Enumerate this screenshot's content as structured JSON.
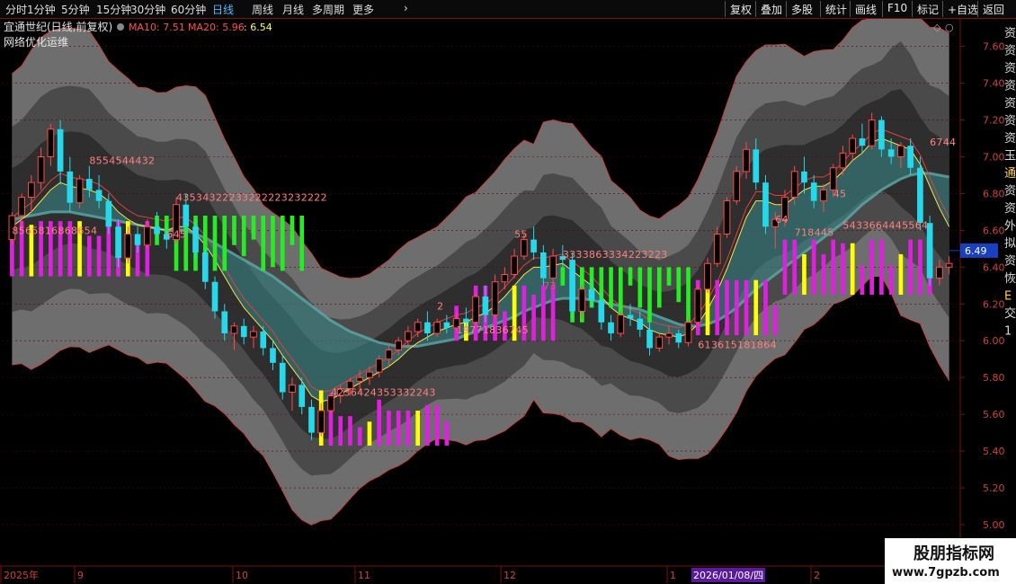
{
  "toolbar": {
    "periods": [
      "分时",
      "1分钟",
      "5分钟",
      "15分钟",
      "30分钟",
      "60分钟",
      "日线",
      "周线",
      "月线",
      "多周期",
      "更多"
    ],
    "active": "日线",
    "right_buttons": [
      "复权",
      "叠加",
      "多股",
      "统计",
      "画线",
      "F10",
      "标记",
      "+自选",
      "返回"
    ]
  },
  "legend": {
    "title": "宜通世纪(日线,前复权)",
    "ma10": "MA10: 7.51",
    "ma20": "MA20: 5.96",
    "extra": ": 6.54",
    "indicator": "网络优化运维"
  },
  "colors": {
    "up": "#ff4a4a",
    "down": "#26d9ea",
    "magenta": "#e020e0",
    "green": "#22ee22",
    "yellow": "#ffff00",
    "teal": "#3a8c8c",
    "axis": "#7a1010"
  },
  "date_axis": {
    "labels": [
      "2025年",
      "9",
      "10",
      "11",
      "12",
      "1",
      "2"
    ],
    "cursor": "2026/01/08/四"
  },
  "price_tag": "6.49",
  "watermark": {
    "title": "股朋指标网",
    "url": "www.7gpzb.com"
  },
  "right_glyphs": [
    "资",
    "资",
    "资",
    "资",
    "资",
    "资",
    "资",
    "玉",
    "通",
    "资",
    "资",
    "外",
    "拟",
    "资",
    "恢",
    "E",
    "交",
    "1"
  ],
  "chart_data": {
    "type": "candlestick",
    "y_ticks": [
      7.6,
      7.4,
      7.2,
      7.0,
      6.8,
      6.6,
      6.4,
      6.2,
      6.0,
      5.8,
      5.6,
      5.4,
      5.2,
      5.0
    ],
    "ylim": [
      4.78,
      7.74
    ],
    "candles": [
      [
        6.55,
        6.7,
        6.52,
        6.68
      ],
      [
        6.68,
        6.8,
        6.6,
        6.78
      ],
      [
        6.78,
        6.9,
        6.7,
        6.86
      ],
      [
        6.86,
        7.05,
        6.82,
        7.0
      ],
      [
        7.0,
        7.18,
        6.95,
        7.15
      ],
      [
        7.15,
        7.2,
        6.85,
        6.92
      ],
      [
        6.92,
        7.0,
        6.7,
        6.75
      ],
      [
        6.75,
        6.9,
        6.72,
        6.88
      ],
      [
        6.88,
        6.95,
        6.78,
        6.82
      ],
      [
        6.82,
        6.9,
        6.72,
        6.76
      ],
      [
        6.76,
        6.8,
        6.58,
        6.62
      ],
      [
        6.62,
        6.66,
        6.4,
        6.45
      ],
      [
        6.45,
        6.62,
        6.42,
        6.58
      ],
      [
        6.58,
        6.62,
        6.48,
        6.52
      ],
      [
        6.52,
        6.66,
        6.5,
        6.62
      ],
      [
        6.62,
        6.7,
        6.55,
        6.58
      ],
      [
        6.58,
        6.62,
        6.5,
        6.55
      ],
      [
        6.55,
        6.78,
        6.53,
        6.74
      ],
      [
        6.74,
        6.8,
        6.58,
        6.62
      ],
      [
        6.62,
        6.65,
        6.44,
        6.48
      ],
      [
        6.48,
        6.5,
        6.28,
        6.32
      ],
      [
        6.32,
        6.35,
        6.12,
        6.16
      ],
      [
        6.16,
        6.2,
        6.0,
        6.04
      ],
      [
        6.04,
        6.1,
        5.95,
        6.08
      ],
      [
        6.08,
        6.12,
        5.98,
        6.02
      ],
      [
        6.02,
        6.08,
        5.96,
        6.05
      ],
      [
        6.05,
        6.08,
        5.92,
        5.96
      ],
      [
        5.96,
        6.0,
        5.84,
        5.88
      ],
      [
        5.88,
        5.92,
        5.68,
        5.72
      ],
      [
        5.72,
        5.8,
        5.62,
        5.76
      ],
      [
        5.76,
        5.8,
        5.6,
        5.64
      ],
      [
        5.64,
        5.68,
        5.46,
        5.5
      ],
      [
        5.5,
        5.66,
        5.48,
        5.62
      ],
      [
        5.62,
        5.72,
        5.6,
        5.7
      ],
      [
        5.7,
        5.76,
        5.66,
        5.74
      ],
      [
        5.74,
        5.8,
        5.7,
        5.78
      ],
      [
        5.78,
        5.84,
        5.72,
        5.8
      ],
      [
        5.8,
        5.86,
        5.76,
        5.83
      ],
      [
        5.83,
        5.92,
        5.8,
        5.9
      ],
      [
        5.9,
        5.98,
        5.86,
        5.95
      ],
      [
        5.95,
        6.02,
        5.92,
        6.0
      ],
      [
        6.0,
        6.08,
        5.96,
        6.05
      ],
      [
        6.05,
        6.12,
        6.02,
        6.1
      ],
      [
        6.1,
        6.16,
        6.0,
        6.04
      ],
      [
        6.04,
        6.12,
        6.02,
        6.1
      ],
      [
        6.1,
        6.14,
        6.04,
        6.07
      ],
      [
        6.07,
        6.15,
        6.05,
        6.12
      ],
      [
        6.12,
        6.18,
        6.06,
        6.1
      ],
      [
        6.1,
        6.26,
        6.08,
        6.24
      ],
      [
        6.24,
        6.3,
        6.1,
        6.14
      ],
      [
        6.14,
        6.36,
        6.12,
        6.32
      ],
      [
        6.32,
        6.4,
        6.28,
        6.36
      ],
      [
        6.36,
        6.5,
        6.34,
        6.46
      ],
      [
        6.46,
        6.58,
        6.44,
        6.55
      ],
      [
        6.55,
        6.62,
        6.44,
        6.48
      ],
      [
        6.48,
        6.52,
        6.3,
        6.34
      ],
      [
        6.34,
        6.5,
        6.3,
        6.46
      ],
      [
        6.46,
        6.52,
        6.4,
        6.44
      ],
      [
        6.44,
        6.48,
        6.12,
        6.16
      ],
      [
        6.16,
        6.3,
        6.12,
        6.28
      ],
      [
        6.28,
        6.34,
        6.18,
        6.22
      ],
      [
        6.22,
        6.26,
        6.06,
        6.1
      ],
      [
        6.1,
        6.14,
        6.0,
        6.04
      ],
      [
        6.04,
        6.16,
        6.02,
        6.14
      ],
      [
        6.14,
        6.2,
        6.08,
        6.12
      ],
      [
        6.12,
        6.16,
        6.02,
        6.06
      ],
      [
        6.06,
        6.1,
        5.92,
        5.96
      ],
      [
        5.96,
        6.04,
        5.94,
        6.02
      ],
      [
        6.02,
        6.08,
        5.98,
        6.04
      ],
      [
        6.04,
        6.06,
        5.96,
        5.99
      ],
      [
        5.99,
        6.12,
        5.97,
        6.1
      ],
      [
        6.1,
        6.3,
        6.08,
        6.28
      ],
      [
        6.28,
        6.45,
        6.26,
        6.42
      ],
      [
        6.42,
        6.62,
        6.4,
        6.58
      ],
      [
        6.58,
        6.78,
        6.56,
        6.76
      ],
      [
        6.76,
        6.95,
        6.74,
        6.92
      ],
      [
        6.92,
        7.08,
        6.88,
        7.04
      ],
      [
        7.04,
        7.1,
        6.82,
        6.86
      ],
      [
        6.86,
        6.9,
        6.58,
        6.62
      ],
      [
        6.62,
        6.7,
        6.5,
        6.66
      ],
      [
        6.66,
        6.82,
        6.62,
        6.78
      ],
      [
        6.78,
        6.95,
        6.74,
        6.92
      ],
      [
        6.92,
        7.0,
        6.8,
        6.86
      ],
      [
        6.86,
        6.9,
        6.72,
        6.76
      ],
      [
        6.76,
        6.85,
        6.7,
        6.82
      ],
      [
        6.82,
        6.96,
        6.78,
        6.94
      ],
      [
        6.94,
        7.06,
        6.9,
        7.02
      ],
      [
        7.02,
        7.12,
        6.98,
        7.1
      ],
      [
        7.1,
        7.18,
        7.02,
        7.06
      ],
      [
        7.06,
        7.24,
        7.04,
        7.2
      ],
      [
        7.2,
        7.22,
        7.0,
        7.04
      ],
      [
        7.04,
        7.1,
        6.96,
        7.0
      ],
      [
        7.0,
        7.08,
        6.94,
        7.06
      ],
      [
        7.06,
        7.1,
        6.9,
        6.94
      ],
      [
        6.94,
        7.0,
        6.6,
        6.64
      ],
      [
        6.64,
        6.68,
        6.3,
        6.34
      ],
      [
        6.34,
        6.44,
        6.3,
        6.4
      ],
      [
        6.4,
        6.46,
        6.36,
        6.42
      ]
    ],
    "ma_short": [
      6.62,
      6.66,
      6.7,
      6.76,
      6.82,
      6.86,
      6.84,
      6.83,
      6.82,
      6.8,
      6.76,
      6.7,
      6.66,
      6.63,
      6.62,
      6.61,
      6.6,
      6.62,
      6.62,
      6.58,
      6.52,
      6.44,
      6.35,
      6.26,
      6.18,
      6.12,
      6.06,
      6.0,
      5.92,
      5.85,
      5.78,
      5.7,
      5.67,
      5.68,
      5.71,
      5.74,
      5.77,
      5.8,
      5.83,
      5.86,
      5.9,
      5.95,
      5.99,
      6.02,
      6.05,
      6.07,
      6.09,
      6.1,
      6.13,
      6.15,
      6.19,
      6.24,
      6.3,
      6.36,
      6.4,
      6.4,
      6.41,
      6.42,
      6.38,
      6.34,
      6.3,
      6.24,
      6.18,
      6.14,
      6.12,
      6.1,
      6.06,
      6.04,
      6.03,
      6.02,
      6.04,
      6.09,
      6.17,
      6.27,
      6.39,
      6.53,
      6.67,
      6.76,
      6.76,
      6.74,
      6.74,
      6.78,
      6.82,
      6.84,
      6.84,
      6.87,
      6.92,
      6.98,
      7.02,
      7.08,
      7.1,
      7.08,
      7.06,
      7.04,
      6.96,
      6.84,
      6.72,
      6.62
    ],
    "ma_long": [
      6.66,
      6.67,
      6.68,
      6.69,
      6.7,
      6.7,
      6.7,
      6.69,
      6.68,
      6.67,
      6.66,
      6.65,
      6.64,
      6.63,
      6.62,
      6.61,
      6.6,
      6.6,
      6.6,
      6.58,
      6.56,
      6.53,
      6.5,
      6.47,
      6.44,
      6.41,
      6.38,
      6.35,
      6.31,
      6.27,
      6.23,
      6.19,
      6.15,
      6.11,
      6.08,
      6.05,
      6.03,
      6.01,
      5.99,
      5.98,
      5.97,
      5.97,
      5.97,
      5.98,
      5.99,
      6.0,
      6.01,
      6.03,
      6.05,
      6.07,
      6.09,
      6.11,
      6.13,
      6.16,
      6.18,
      6.2,
      6.22,
      6.23,
      6.23,
      6.23,
      6.22,
      6.21,
      6.2,
      6.19,
      6.18,
      6.17,
      6.15,
      6.13,
      6.11,
      6.09,
      6.08,
      6.08,
      6.09,
      6.11,
      6.14,
      6.18,
      6.23,
      6.28,
      6.32,
      6.36,
      6.4,
      6.44,
      6.48,
      6.52,
      6.56,
      6.6,
      6.64,
      6.69,
      6.74,
      6.78,
      6.82,
      6.85,
      6.88,
      6.9,
      6.91,
      6.91,
      6.9,
      6.89
    ],
    "hist_groups": [
      {
        "from": 0,
        "to": 14,
        "kind": "magenta",
        "value_label": "8565816865 4"
      },
      {
        "from": 15,
        "to": 30,
        "kind": "green",
        "value_label": "435343222332222232222"
      },
      {
        "from": 32,
        "to": 45,
        "kind": "magenta",
        "value_label": "42364243533322 43"
      },
      {
        "from": 46,
        "to": 56,
        "kind": "magenta",
        "value_label": "19771836745"
      },
      {
        "from": 57,
        "to": 70,
        "kind": "green",
        "value_label": "3333863334223223"
      },
      {
        "from": 71,
        "to": 79,
        "kind": "magenta",
        "value_label": "613615181864"
      },
      {
        "from": 80,
        "to": 95,
        "kind": "magenta",
        "value_label": "5433664445564"
      }
    ],
    "text_labels": [
      {
        "i": 8,
        "price": 6.96,
        "text": "8554544432",
        "color": "#ff8080"
      },
      {
        "i": 0,
        "price": 6.58,
        "text": "8565816868654",
        "color": "#ff8080"
      },
      {
        "i": 16,
        "price": 6.56,
        "text": "645",
        "color": "#ff8080"
      },
      {
        "i": 17,
        "price": 6.76,
        "text": "43534322233222223232222",
        "color": "#ff8080"
      },
      {
        "i": 33,
        "price": 5.7,
        "text": "4236424353332243",
        "color": "#ff8080"
      },
      {
        "i": 44,
        "price": 6.17,
        "text": "2",
        "color": "#ff8080"
      },
      {
        "i": 46,
        "price": 6.04,
        "text": "19771836745",
        "color": "#ff8080"
      },
      {
        "i": 52,
        "price": 6.56,
        "text": "55",
        "color": "#ff8080"
      },
      {
        "i": 55,
        "price": 6.28,
        "text": "73",
        "color": "#ff4080"
      },
      {
        "i": 57,
        "price": 6.45,
        "text": "3333863334223223",
        "color": "#ff8080"
      },
      {
        "i": 71,
        "price": 5.96,
        "text": "613615181864",
        "color": "#ff8080"
      },
      {
        "i": 79,
        "price": 6.64,
        "text": "64",
        "color": "#ff8080"
      },
      {
        "i": 81,
        "price": 6.57,
        "text": "718445",
        "color": "#ff8080"
      },
      {
        "i": 85,
        "price": 6.78,
        "text": "45",
        "color": "#ff8080"
      },
      {
        "i": 86,
        "price": 6.61,
        "text": "5433664445564",
        "color": "#ff8080"
      },
      {
        "i": 95,
        "price": 7.06,
        "text": "6744",
        "color": "#ff8080"
      }
    ]
  }
}
